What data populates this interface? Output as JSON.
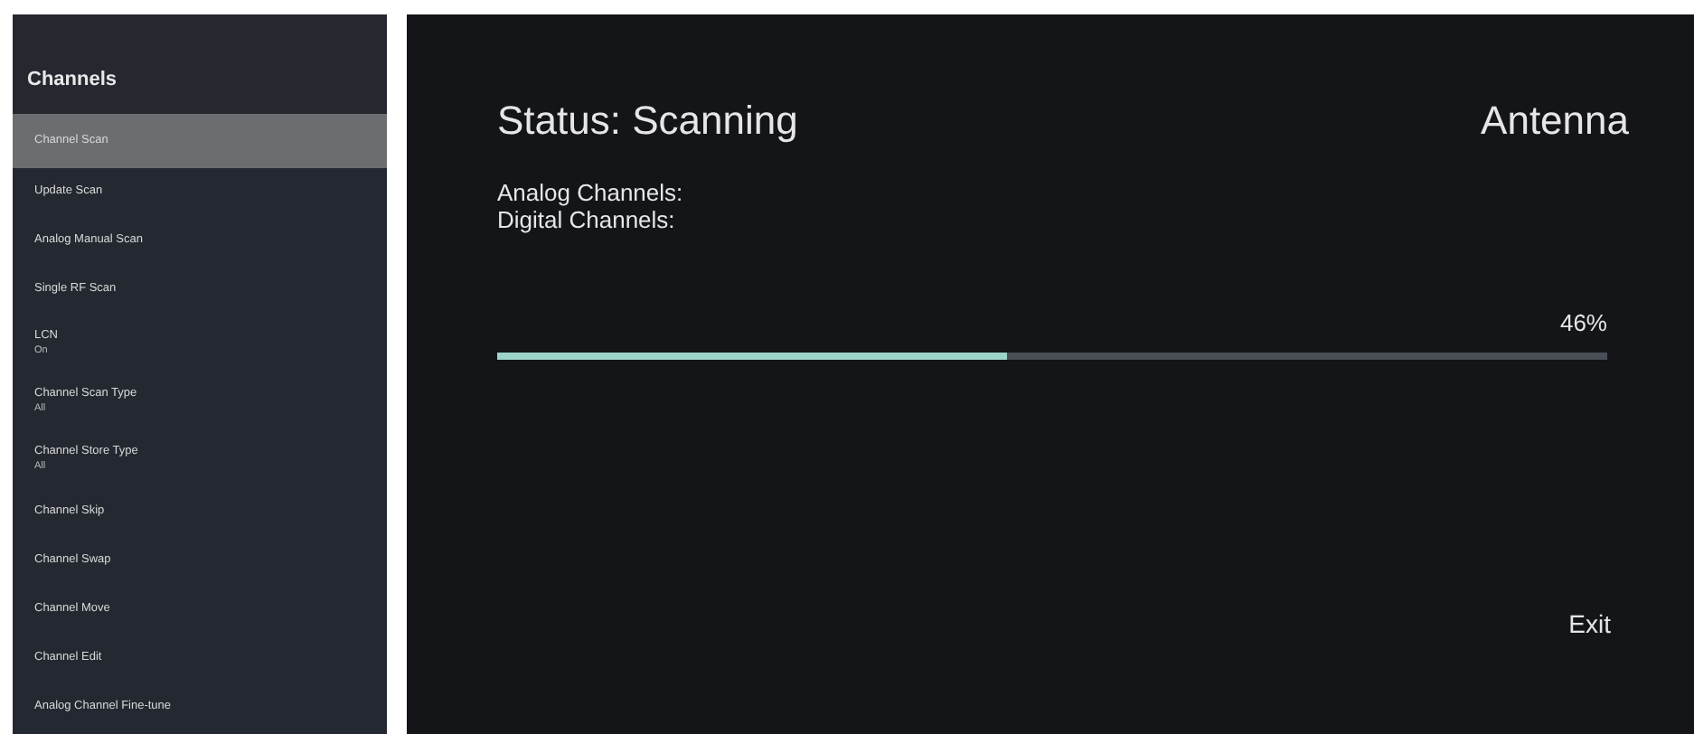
{
  "sidebar": {
    "title": "Channels",
    "items": [
      {
        "label": "Channel Scan",
        "selected": true
      },
      {
        "label": "Update Scan",
        "selected": false
      },
      {
        "label": "Analog Manual Scan",
        "selected": false
      },
      {
        "label": "Single RF Scan",
        "selected": false
      },
      {
        "label": "LCN",
        "value": "On",
        "selected": false
      },
      {
        "label": "Channel Scan Type",
        "value": "All",
        "selected": false
      },
      {
        "label": "Channel Store Type",
        "value": "All",
        "selected": false
      },
      {
        "label": "Channel Skip",
        "selected": false
      },
      {
        "label": "Channel Swap",
        "selected": false
      },
      {
        "label": "Channel Move",
        "selected": false
      },
      {
        "label": "Channel Edit",
        "selected": false
      },
      {
        "label": "Analog Channel Fine-tune",
        "selected": false
      }
    ]
  },
  "scan": {
    "status": "Status: Scanning",
    "source": "Antenna",
    "counts": [
      "Analog Channels:",
      "Digital Channels:"
    ],
    "percent": "46%",
    "level": 0.46,
    "exit": "Exit"
  }
}
